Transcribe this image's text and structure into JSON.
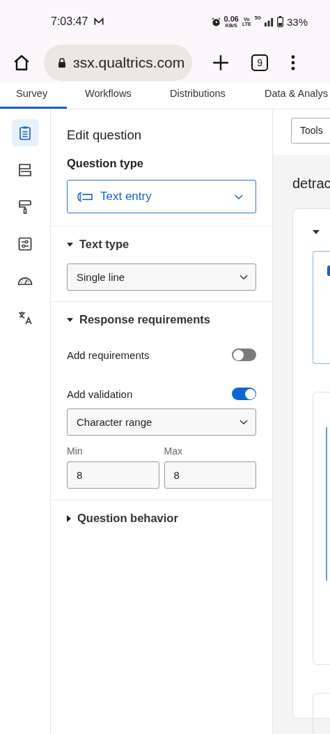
{
  "status_bar": {
    "time": "7:03:47",
    "net_speed": "0.06",
    "net_unit": "KB/S",
    "volte_top": "Vo",
    "volte_bottom": "LTE",
    "network": "5G",
    "battery": "33%"
  },
  "browser": {
    "url": "ɜsx.qualtrics.com",
    "tab_count": "9"
  },
  "nav_tabs": [
    {
      "label": "Survey",
      "selected": true
    },
    {
      "label": "Workflows",
      "selected": false
    },
    {
      "label": "Distributions",
      "selected": false
    },
    {
      "label": "Data & Analys",
      "selected": false
    }
  ],
  "sidebar_icons": [
    {
      "kind": "clipboard",
      "selected": true
    },
    {
      "kind": "blocks",
      "selected": false
    },
    {
      "kind": "paint-roller",
      "selected": false
    },
    {
      "kind": "sliders",
      "selected": false
    },
    {
      "kind": "gauge",
      "selected": false
    },
    {
      "kind": "translate",
      "selected": false
    }
  ],
  "panel": {
    "title": "Edit question",
    "question_type_label": "Question type",
    "question_type": "Text entry",
    "text_type": {
      "title": "Text type",
      "expanded": true,
      "value": "Single line"
    },
    "response_requirements": {
      "title": "Response requirements",
      "expanded": true,
      "toggles": [
        {
          "label": "Add requirements",
          "on": false
        },
        {
          "label": "Add validation",
          "on": true
        }
      ],
      "validation_type": "Character range",
      "min": {
        "label": "Min",
        "value": "8"
      },
      "max": {
        "label": "Max",
        "value": "8"
      }
    },
    "question_behavior": {
      "title": "Question behavior",
      "expanded": false
    }
  },
  "preview": {
    "tools_button": "Tools",
    "question_title": "detrac"
  }
}
